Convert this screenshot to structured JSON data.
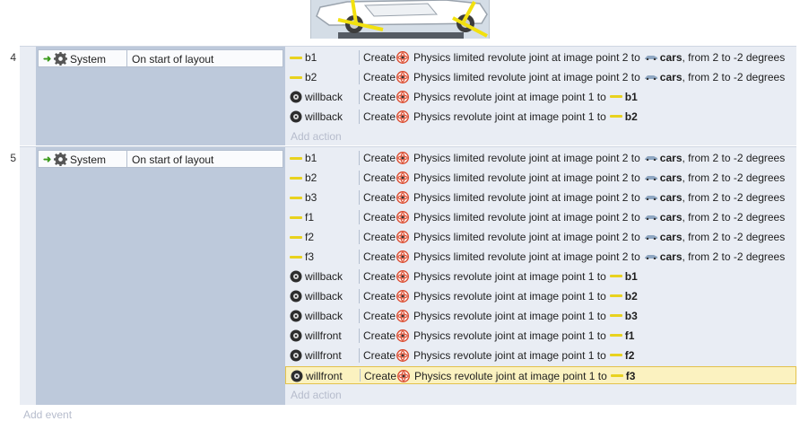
{
  "events": [
    {
      "number": "4",
      "condition": {
        "object": "System",
        "text": "On start of layout"
      },
      "actions": [
        {
          "object": "b1",
          "icon": "yellow-line-icon",
          "verb": "Create",
          "behavior": "Physics limited revolute joint at image point 2 to",
          "target": "cars",
          "target_icon": "car-icon",
          "suffix": ", from 2 to -2 degrees"
        },
        {
          "object": "b2",
          "icon": "yellow-line-icon",
          "verb": "Create",
          "behavior": "Physics limited revolute joint at image point 2 to",
          "target": "cars",
          "target_icon": "car-icon",
          "suffix": ", from 2 to -2 degrees"
        },
        {
          "object": "willback",
          "icon": "wheel-icon",
          "verb": "Create",
          "behavior": "Physics revolute joint at image point 1 to",
          "target": "b1",
          "target_icon": "yellow-line-icon",
          "suffix": ""
        },
        {
          "object": "willback",
          "icon": "wheel-icon",
          "verb": "Create",
          "behavior": "Physics revolute joint at image point 1 to",
          "target": "b2",
          "target_icon": "yellow-line-icon",
          "suffix": ""
        }
      ],
      "add_action": "Add action"
    },
    {
      "number": "5",
      "condition": {
        "object": "System",
        "text": "On start of layout"
      },
      "actions": [
        {
          "object": "b1",
          "icon": "yellow-line-icon",
          "verb": "Create",
          "behavior": "Physics limited revolute joint at image point 2 to",
          "target": "cars",
          "target_icon": "car-icon",
          "suffix": ", from 2 to -2 degrees"
        },
        {
          "object": "b2",
          "icon": "yellow-line-icon",
          "verb": "Create",
          "behavior": "Physics limited revolute joint at image point 2 to",
          "target": "cars",
          "target_icon": "car-icon",
          "suffix": ", from 2 to -2 degrees"
        },
        {
          "object": "b3",
          "icon": "yellow-line-icon",
          "verb": "Create",
          "behavior": "Physics limited revolute joint at image point 2 to",
          "target": "cars",
          "target_icon": "car-icon",
          "suffix": ", from 2 to -2 degrees"
        },
        {
          "object": "f1",
          "icon": "yellow-line-icon",
          "verb": "Create",
          "behavior": "Physics limited revolute joint at image point 2 to",
          "target": "cars",
          "target_icon": "car-icon",
          "suffix": ", from 2 to -2 degrees"
        },
        {
          "object": "f2",
          "icon": "yellow-line-icon",
          "verb": "Create",
          "behavior": "Physics limited revolute joint at image point 2 to",
          "target": "cars",
          "target_icon": "car-icon",
          "suffix": ", from 2 to -2 degrees"
        },
        {
          "object": "f3",
          "icon": "yellow-line-icon",
          "verb": "Create",
          "behavior": "Physics limited revolute joint at image point 2 to",
          "target": "cars",
          "target_icon": "car-icon",
          "suffix": ", from 2 to -2 degrees"
        },
        {
          "object": "willback",
          "icon": "wheel-icon",
          "verb": "Create",
          "behavior": "Physics revolute joint at image point 1 to",
          "target": "b1",
          "target_icon": "yellow-line-icon",
          "suffix": ""
        },
        {
          "object": "willback",
          "icon": "wheel-icon",
          "verb": "Create",
          "behavior": "Physics revolute joint at image point 1 to",
          "target": "b2",
          "target_icon": "yellow-line-icon",
          "suffix": ""
        },
        {
          "object": "willback",
          "icon": "wheel-icon",
          "verb": "Create",
          "behavior": "Physics revolute joint at image point 1 to",
          "target": "b3",
          "target_icon": "yellow-line-icon",
          "suffix": ""
        },
        {
          "object": "willfront",
          "icon": "wheel-icon",
          "verb": "Create",
          "behavior": "Physics revolute joint at image point 1 to",
          "target": "f1",
          "target_icon": "yellow-line-icon",
          "suffix": ""
        },
        {
          "object": "willfront",
          "icon": "wheel-icon",
          "verb": "Create",
          "behavior": "Physics revolute joint at image point 1 to",
          "target": "f2",
          "target_icon": "yellow-line-icon",
          "suffix": ""
        },
        {
          "object": "willfront",
          "icon": "wheel-icon",
          "verb": "Create",
          "behavior": "Physics revolute joint at image point 1 to",
          "target": "f3",
          "target_icon": "yellow-line-icon",
          "suffix": "",
          "selected": true
        }
      ],
      "add_action": "Add action"
    }
  ],
  "add_event": "Add event",
  "colors": {
    "selected_row": "#fbf2c0",
    "condition_column": "#bdc9db",
    "action_area": "#e9edf4",
    "joint_line": "#e8d21e"
  }
}
